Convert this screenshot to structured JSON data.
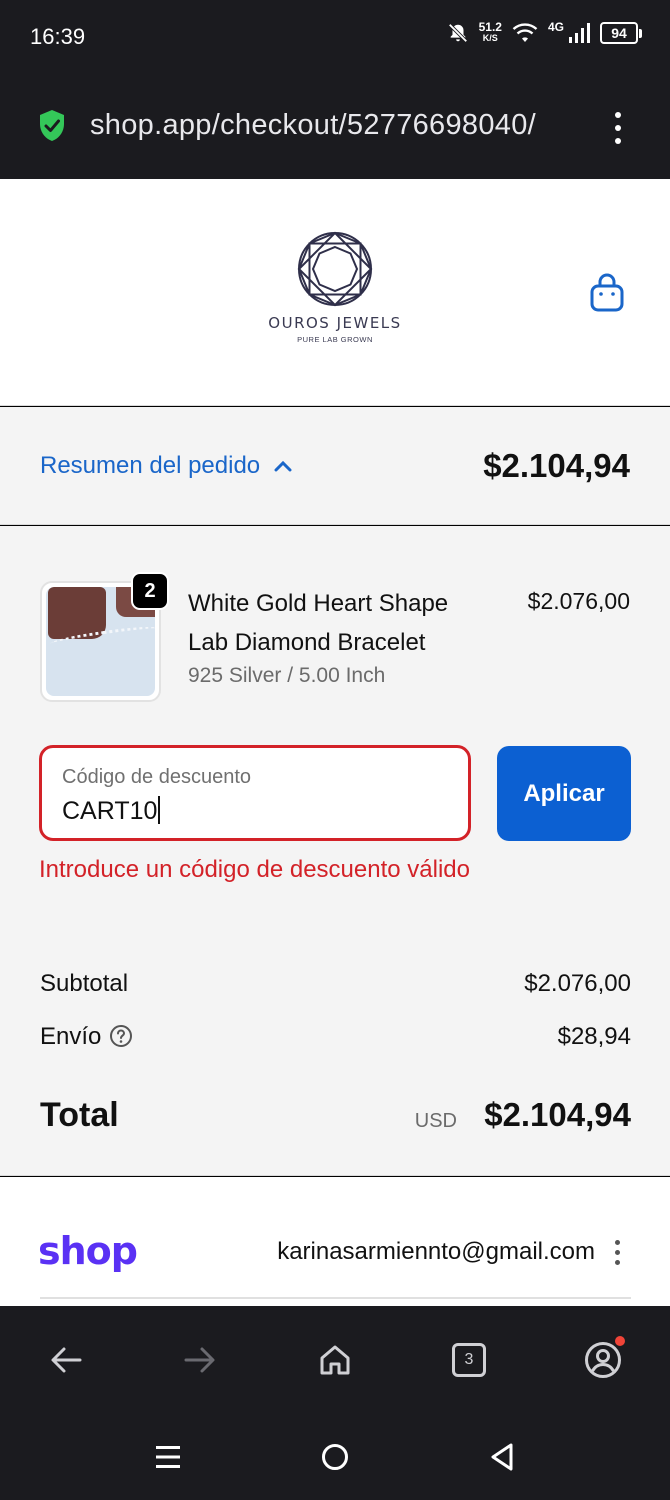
{
  "status_bar": {
    "time": "16:39",
    "net_speed_value": "51.2",
    "net_speed_unit": "K/S",
    "network_type": "4G",
    "battery": "94"
  },
  "browser": {
    "url": "shop.app/checkout/52776698040/"
  },
  "store": {
    "name": "OUROS JEWELS",
    "tagline": "PURE LAB GROWN"
  },
  "order_summary": {
    "toggle_label": "Resumen del pedido",
    "total": "$2.104,94"
  },
  "product": {
    "quantity": "2",
    "name": "White Gold Heart Shape Lab Diamond Bracelet",
    "variant": "925 Silver / 5.00 Inch",
    "price": "$2.076,00"
  },
  "discount": {
    "label": "Código de descuento",
    "value": "CART10",
    "apply_label": "Aplicar",
    "error": "Introduce un código de descuento válido"
  },
  "totals": {
    "subtotal_label": "Subtotal",
    "subtotal": "$2.076,00",
    "shipping_label": "Envío",
    "shipping": "$28,94",
    "total_label": "Total",
    "currency": "USD",
    "total": "$2.104,94"
  },
  "shop_pay": {
    "logo": "shop",
    "email": "karinasarmiennto@gmail.com"
  },
  "browser_nav": {
    "tab_count": "3"
  },
  "colors": {
    "link": "#1a66c9",
    "button": "#0c60d2",
    "error": "#d32228",
    "shop_brand": "#5a31f4",
    "secure": "#34c759"
  }
}
